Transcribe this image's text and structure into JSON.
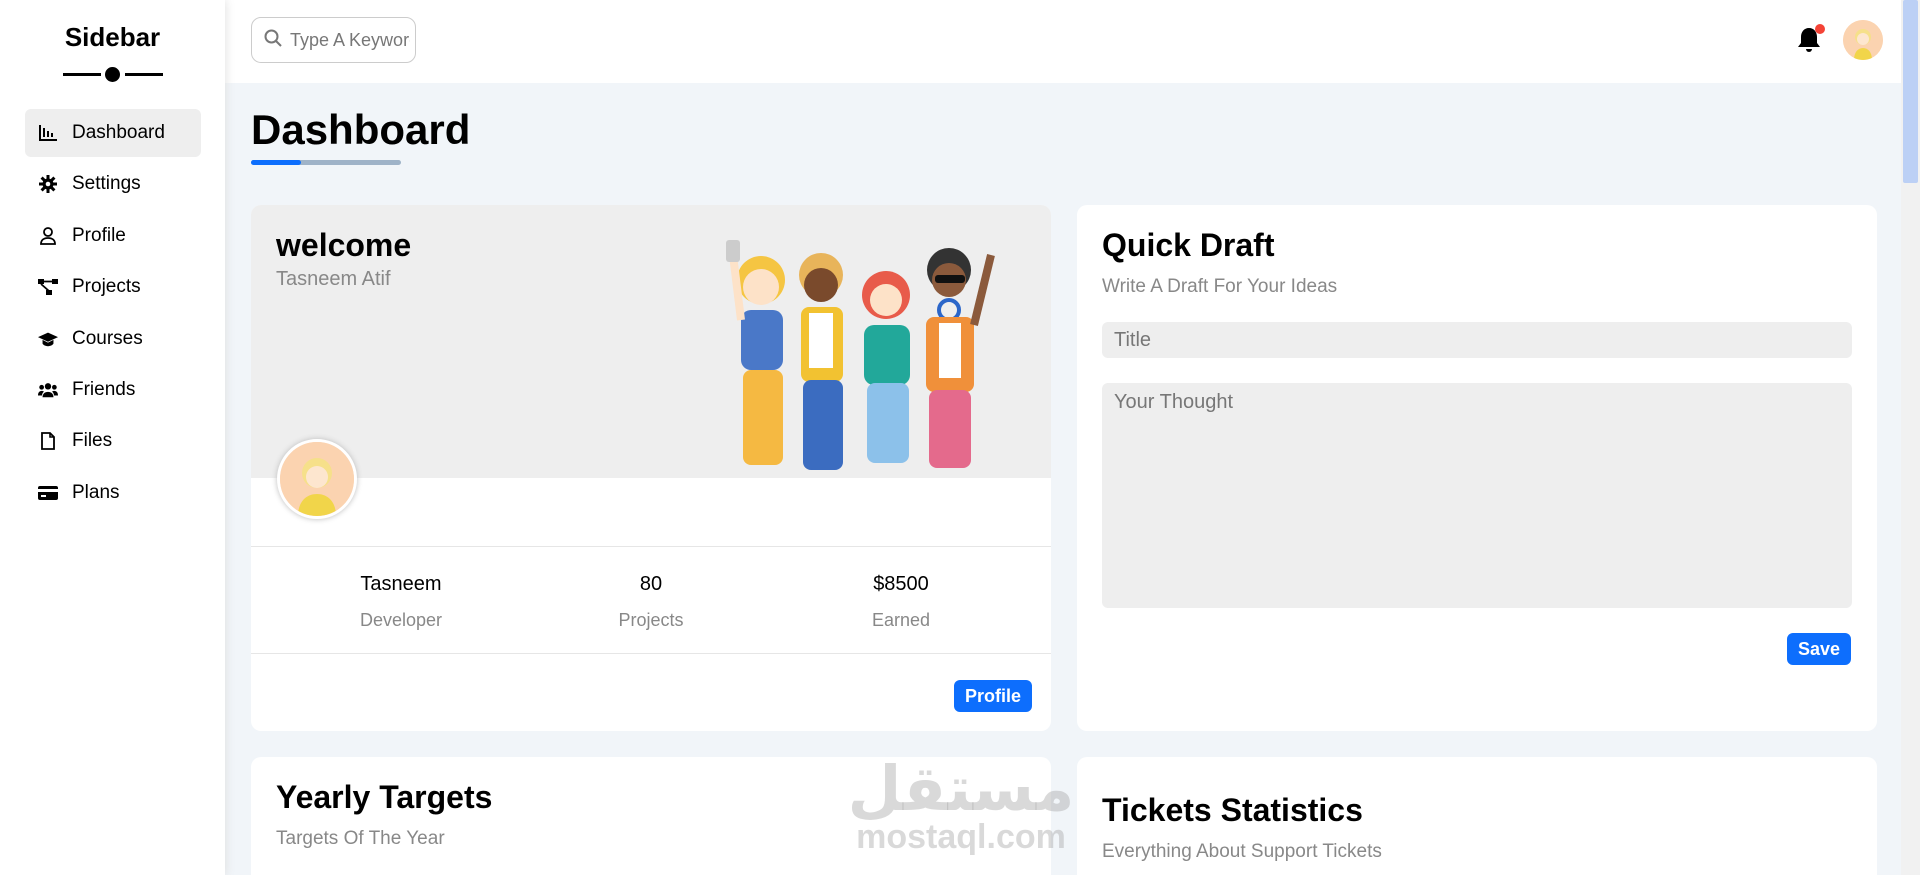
{
  "sidebar": {
    "title": "Sidebar",
    "items": [
      {
        "label": "Dashboard",
        "icon": "chart-icon",
        "active": true
      },
      {
        "label": "Settings",
        "icon": "gear-icon"
      },
      {
        "label": "Profile",
        "icon": "user-icon"
      },
      {
        "label": "Projects",
        "icon": "diagram-icon"
      },
      {
        "label": "Courses",
        "icon": "graduation-cap-icon"
      },
      {
        "label": "Friends",
        "icon": "users-icon"
      },
      {
        "label": "Files",
        "icon": "file-icon"
      },
      {
        "label": "Plans",
        "icon": "credit-card-icon"
      }
    ]
  },
  "header": {
    "search_placeholder": "Type A Keyword",
    "notification_badge_color": "#f44336"
  },
  "main": {
    "page_title": "Dashboard",
    "welcome": {
      "title": "welcome",
      "name": "Tasneem Atif",
      "stats": [
        {
          "value": "Tasneem",
          "label": "Developer"
        },
        {
          "value": "80",
          "label": "Projects"
        },
        {
          "value": "$8500",
          "label": "Earned"
        }
      ],
      "profile_button": "Profile"
    },
    "quick_draft": {
      "title": "Quick Draft",
      "subtitle": "Write A Draft For Your Ideas",
      "title_placeholder": "Title",
      "thought_placeholder": "Your Thought",
      "save_button": "Save"
    },
    "yearly_targets": {
      "title": "Yearly Targets",
      "subtitle": "Targets Of The Year"
    },
    "tickets": {
      "title": "Tickets Statistics",
      "subtitle": "Everything About Support Tickets"
    }
  },
  "watermark": {
    "arabic": "مستقل",
    "latin": "mostaql.com"
  },
  "colors": {
    "accent": "#0d6efd",
    "background": "#f1f5f9",
    "card": "#ffffff",
    "muted_text": "#888888"
  }
}
